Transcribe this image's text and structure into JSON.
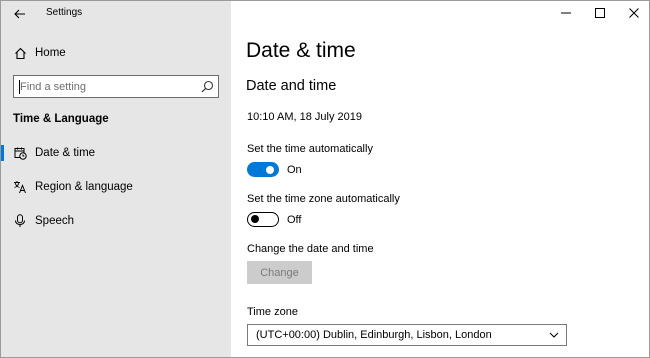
{
  "window": {
    "title": "Settings"
  },
  "sidebar": {
    "home_label": "Home",
    "search_placeholder": "Find a setting",
    "section_heading": "Time & Language",
    "items": [
      {
        "label": "Date & time",
        "icon": "calendar-clock-icon",
        "selected": true
      },
      {
        "label": "Region & language",
        "icon": "language-icon",
        "selected": false
      },
      {
        "label": "Speech",
        "icon": "microphone-icon",
        "selected": false
      }
    ]
  },
  "main": {
    "page_title": "Date & time",
    "section_title": "Date and time",
    "current_datetime": "10:10 AM, 18 July 2019",
    "auto_time": {
      "label": "Set the time automatically",
      "state": "On",
      "on": true
    },
    "auto_timezone": {
      "label": "Set the time zone automatically",
      "state": "Off",
      "on": false
    },
    "change_label": "Change the date and time",
    "change_button": "Change",
    "timezone_label": "Time zone",
    "timezone_value": "(UTC+00:00) Dublin, Edinburgh, Lisbon, London"
  },
  "colors": {
    "accent": "#0078d7",
    "sidebar_bg": "#e6e6e6",
    "disabled_button_bg": "#cccccc"
  }
}
